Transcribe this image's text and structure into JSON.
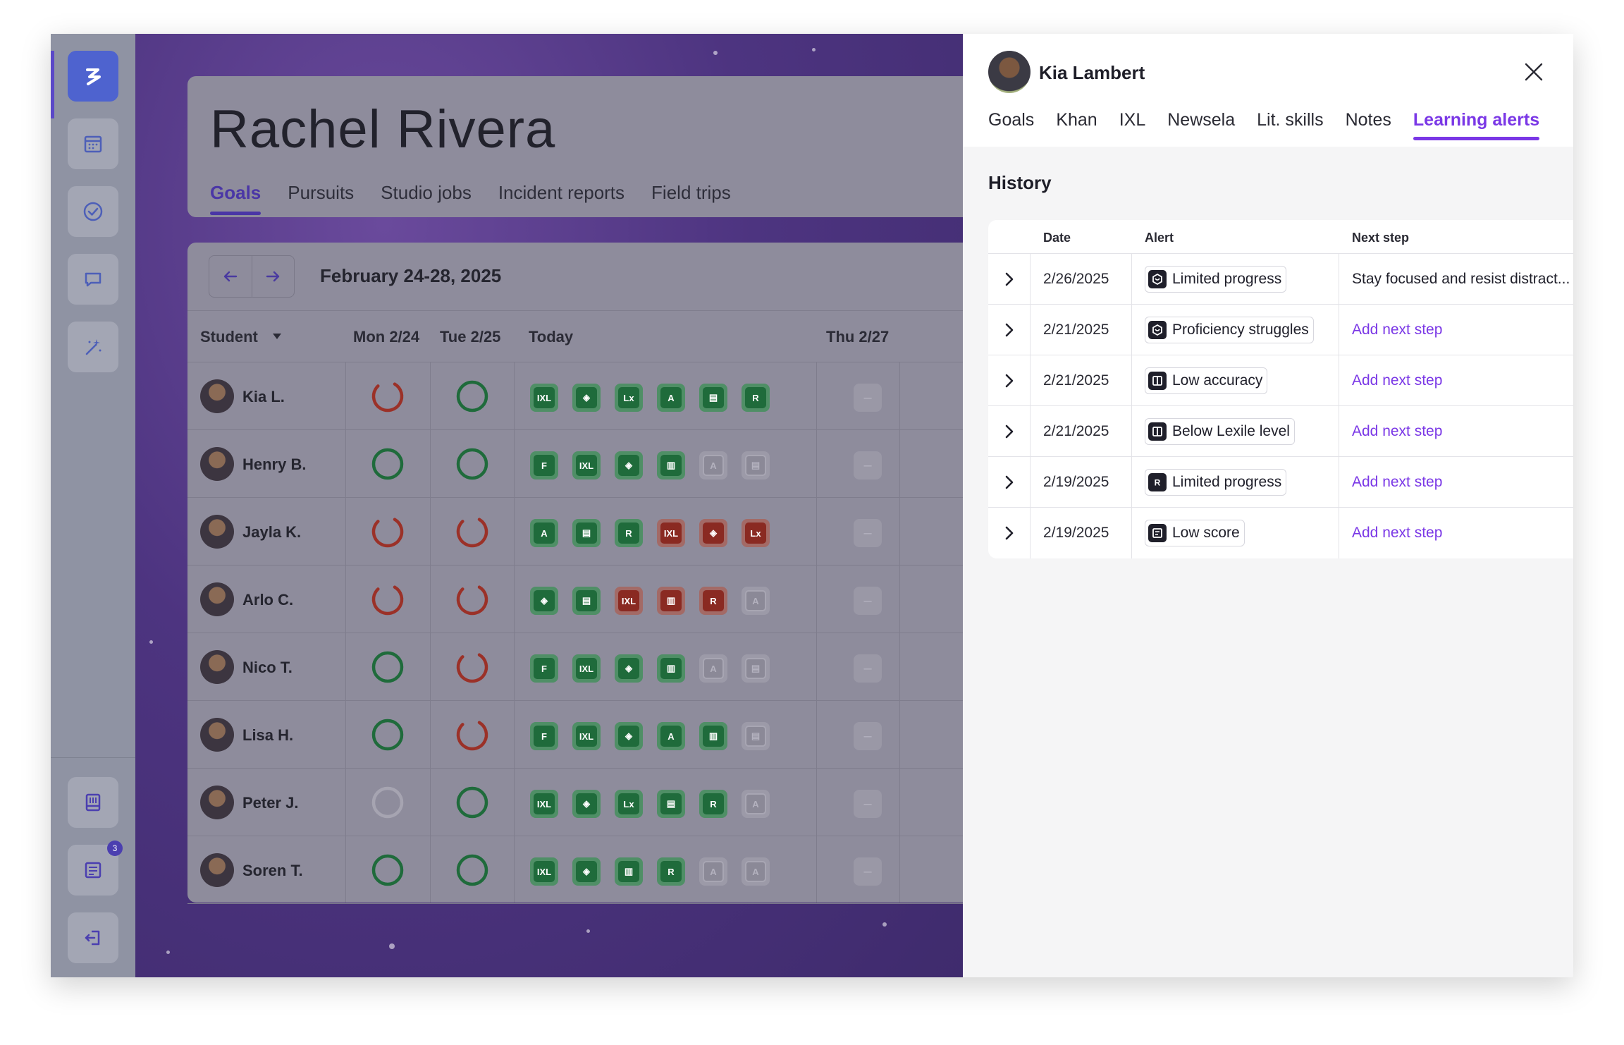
{
  "rail": {
    "items": [
      {
        "name": "logo",
        "icon": "lightning-icon"
      },
      {
        "name": "calendar",
        "icon": "calendar-icon"
      },
      {
        "name": "goals",
        "icon": "check-circle-icon"
      },
      {
        "name": "messages",
        "icon": "chat-icon"
      },
      {
        "name": "magic",
        "icon": "magic-wand-icon"
      },
      {
        "name": "library",
        "icon": "book-icon"
      },
      {
        "name": "reports",
        "icon": "report-icon",
        "badge": "3"
      },
      {
        "name": "logout",
        "icon": "logout-icon"
      }
    ]
  },
  "background": {
    "title": "Rachel Rivera",
    "tabs": [
      "Goals",
      "Pursuits",
      "Studio jobs",
      "Incident reports",
      "Field trips"
    ],
    "active_tab": "Goals",
    "week_label": "February 24-28, 2025",
    "columns": [
      "Student",
      "Mon 2/24",
      "Tue 2/25",
      "Today",
      "Thu 2/27"
    ],
    "students": [
      {
        "name": "Kia L.",
        "mon": "partial",
        "tue": "complete",
        "apps": [
          [
            "green",
            "IXL"
          ],
          [
            "green",
            "◈"
          ],
          [
            "green",
            "Lx"
          ],
          [
            "green",
            "A"
          ],
          [
            "green",
            "▤"
          ],
          [
            "green",
            "R"
          ]
        ]
      },
      {
        "name": "Henry B.",
        "mon": "complete",
        "tue": "complete",
        "apps": [
          [
            "green",
            "F"
          ],
          [
            "green",
            "IXL"
          ],
          [
            "green",
            "◈"
          ],
          [
            "green",
            "▥"
          ],
          [
            "grey",
            "A"
          ],
          [
            "grey",
            "▤"
          ]
        ]
      },
      {
        "name": "Jayla K.",
        "mon": "partial",
        "tue": "partial",
        "apps": [
          [
            "green",
            "A"
          ],
          [
            "green",
            "▤"
          ],
          [
            "green",
            "R"
          ],
          [
            "red",
            "IXL"
          ],
          [
            "red",
            "◈"
          ],
          [
            "red",
            "Lx"
          ]
        ]
      },
      {
        "name": "Arlo C.",
        "mon": "partial",
        "tue": "partial",
        "apps": [
          [
            "green",
            "◈"
          ],
          [
            "green",
            "▤"
          ],
          [
            "red",
            "IXL"
          ],
          [
            "red",
            "▥"
          ],
          [
            "red",
            "R"
          ],
          [
            "grey",
            "A"
          ]
        ]
      },
      {
        "name": "Nico T.",
        "mon": "complete",
        "tue": "partial",
        "apps": [
          [
            "green",
            "F"
          ],
          [
            "green",
            "IXL"
          ],
          [
            "green",
            "◈"
          ],
          [
            "green",
            "▥"
          ],
          [
            "grey",
            "A"
          ],
          [
            "grey",
            "▤"
          ]
        ]
      },
      {
        "name": "Lisa H.",
        "mon": "complete",
        "tue": "partial",
        "apps": [
          [
            "green",
            "F"
          ],
          [
            "green",
            "IXL"
          ],
          [
            "green",
            "◈"
          ],
          [
            "green",
            "A"
          ],
          [
            "green",
            "▥"
          ],
          [
            "grey",
            "▤"
          ]
        ]
      },
      {
        "name": "Peter J.",
        "mon": "empty",
        "tue": "complete",
        "apps": [
          [
            "green",
            "IXL"
          ],
          [
            "green",
            "◈"
          ],
          [
            "green",
            "Lx"
          ],
          [
            "green",
            "▤"
          ],
          [
            "green",
            "R"
          ],
          [
            "grey",
            "A"
          ]
        ]
      },
      {
        "name": "Soren T.",
        "mon": "complete",
        "tue": "complete",
        "apps": [
          [
            "green",
            "IXL"
          ],
          [
            "green",
            "◈"
          ],
          [
            "green",
            "▥"
          ],
          [
            "green",
            "R"
          ],
          [
            "grey",
            "A"
          ],
          [
            "grey",
            "A"
          ]
        ]
      }
    ],
    "thu_placeholder": "–"
  },
  "panel": {
    "student_name": "Kia Lambert",
    "tabs": [
      "Goals",
      "Khan",
      "IXL",
      "Newsela",
      "Lit. skills",
      "Notes",
      "Learning alerts"
    ],
    "active_tab": "Learning alerts",
    "section_title": "History",
    "table": {
      "headers": {
        "date": "Date",
        "alert": "Alert",
        "next_step": "Next step"
      },
      "rows": [
        {
          "date": "2/26/2025",
          "alert": "Limited progress",
          "icon": "khan-icon",
          "next_step": "Stay focused and resist distract...",
          "next_is_link": false
        },
        {
          "date": "2/21/2025",
          "alert": "Proficiency struggles",
          "icon": "khan-icon",
          "next_step": "Add next step",
          "next_is_link": true
        },
        {
          "date": "2/21/2025",
          "alert": "Low accuracy",
          "icon": "book-icon",
          "next_step": "Add next step",
          "next_is_link": true
        },
        {
          "date": "2/21/2025",
          "alert": "Below Lexile level",
          "icon": "book-icon",
          "next_step": "Add next step",
          "next_is_link": true
        },
        {
          "date": "2/19/2025",
          "alert": "Limited progress",
          "icon": "reading-r-icon",
          "next_step": "Add next step",
          "next_is_link": true
        },
        {
          "date": "2/19/2025",
          "alert": "Low score",
          "icon": "quiz-icon",
          "next_step": "Add next step",
          "next_is_link": true
        }
      ]
    }
  },
  "colors": {
    "accent": "#7a37e6",
    "complete": "#1f6b3b",
    "partial": "#9b3128"
  }
}
